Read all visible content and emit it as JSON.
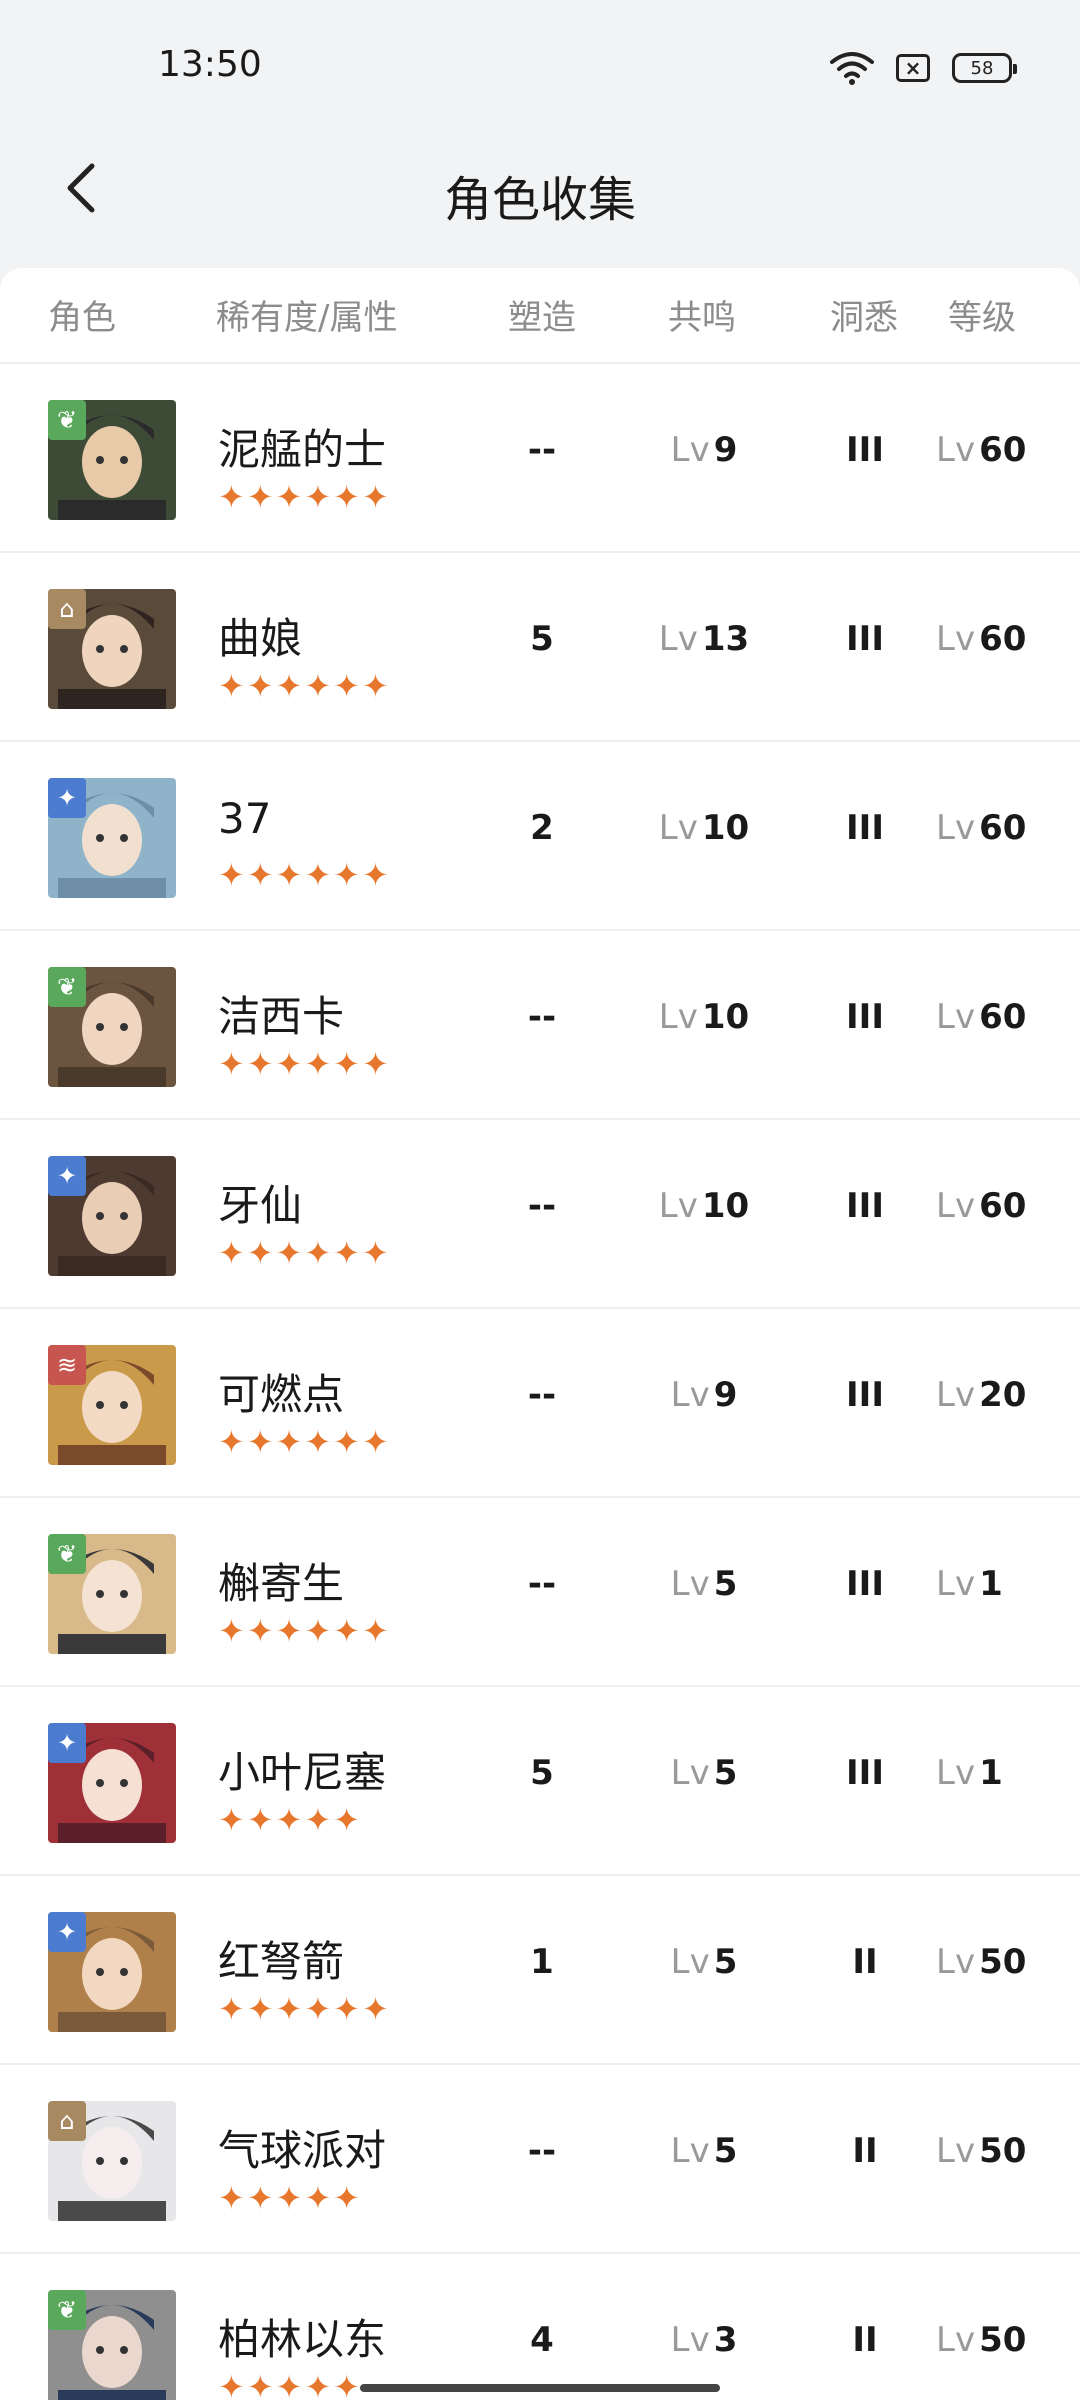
{
  "status_bar": {
    "time": "13:50",
    "battery": "58",
    "icons": [
      "wifi-icon",
      "sim-x-icon",
      "battery-icon"
    ]
  },
  "header": {
    "title": "角色收集",
    "back_icon": "chevron-left-icon"
  },
  "table": {
    "columns": [
      "角色",
      "稀有度/属性",
      "塑造",
      "共鸣",
      "洞悉",
      "等级"
    ],
    "lv_prefix": "Lv",
    "rows": [
      {
        "name": "泥艋的士",
        "stars": "✦✦✦✦✦✦",
        "attr": "leaf",
        "shaping": "--",
        "resonance": "9",
        "insight": "III",
        "level": "60"
      },
      {
        "name": "曲娘",
        "stars": "✦✦✦✦✦✦",
        "attr": "rock",
        "shaping": "5",
        "resonance": "13",
        "insight": "III",
        "level": "60"
      },
      {
        "name": "37",
        "stars": "✦✦✦✦✦✦",
        "attr": "star",
        "shaping": "2",
        "resonance": "10",
        "insight": "III",
        "level": "60"
      },
      {
        "name": "洁西卡",
        "stars": "✦✦✦✦✦✦",
        "attr": "leaf",
        "shaping": "--",
        "resonance": "10",
        "insight": "III",
        "level": "60"
      },
      {
        "name": "牙仙",
        "stars": "✦✦✦✦✦✦",
        "attr": "star",
        "shaping": "--",
        "resonance": "10",
        "insight": "III",
        "level": "60"
      },
      {
        "name": "可燃点",
        "stars": "✦✦✦✦✦✦",
        "attr": "fire",
        "shaping": "--",
        "resonance": "9",
        "insight": "III",
        "level": "20"
      },
      {
        "name": "槲寄生",
        "stars": "✦✦✦✦✦✦",
        "attr": "leaf",
        "shaping": "--",
        "resonance": "5",
        "insight": "III",
        "level": "1"
      },
      {
        "name": "小叶尼塞",
        "stars": "✦✦✦✦✦",
        "attr": "star",
        "shaping": "5",
        "resonance": "5",
        "insight": "III",
        "level": "1"
      },
      {
        "name": "红弩箭",
        "stars": "✦✦✦✦✦✦",
        "attr": "star",
        "shaping": "1",
        "resonance": "5",
        "insight": "II",
        "level": "50"
      },
      {
        "name": "气球派对",
        "stars": "✦✦✦✦✦",
        "attr": "rock",
        "shaping": "--",
        "resonance": "5",
        "insight": "II",
        "level": "50"
      },
      {
        "name": "柏林以东",
        "stars": "✦✦✦✦✦",
        "attr": "leaf",
        "shaping": "4",
        "resonance": "3",
        "insight": "II",
        "level": "50"
      }
    ]
  },
  "colors": {
    "star": "#e8772e",
    "leaf": "#5aa85c",
    "star_attr": "#4b7cd0",
    "rock": "#a88a62",
    "fire": "#c75550"
  }
}
